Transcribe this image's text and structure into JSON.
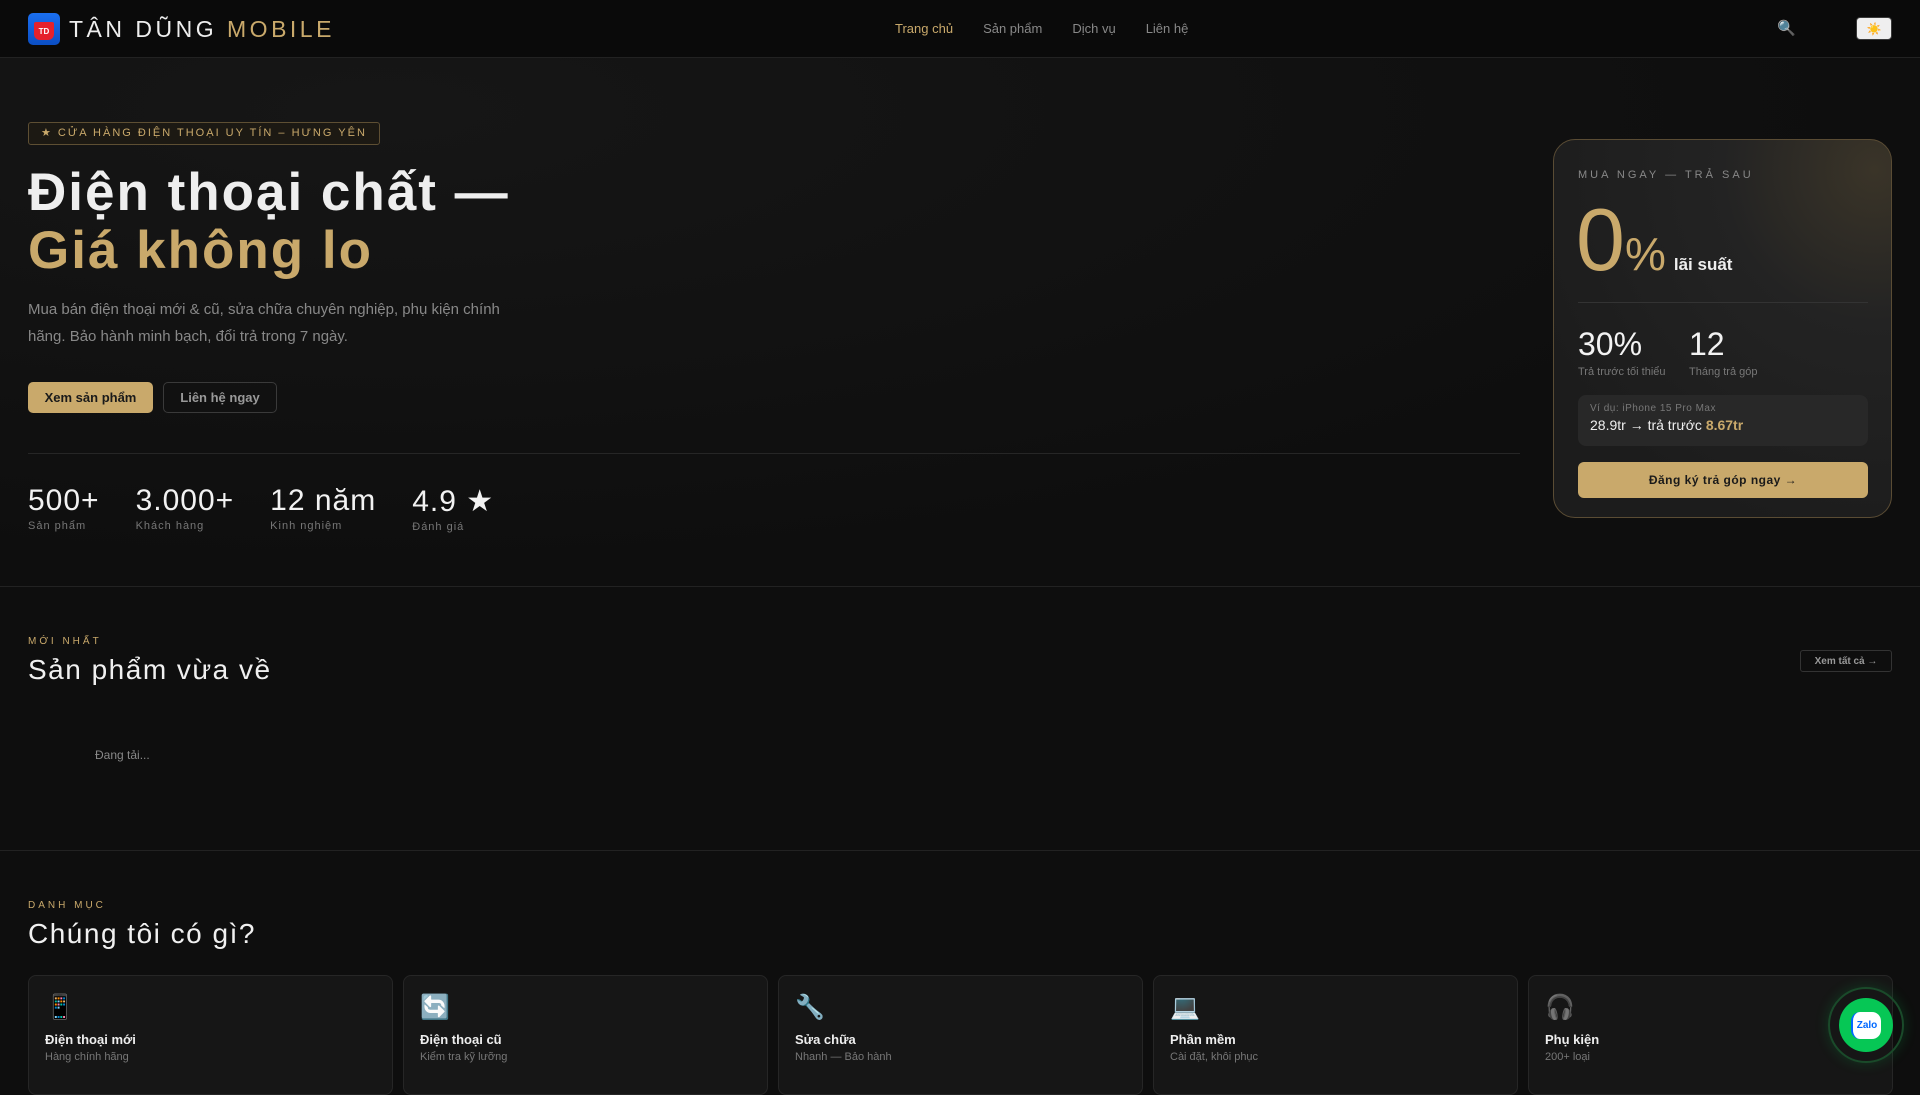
{
  "header": {
    "logo_text": "TD",
    "brand_main": "TÂN DŨNG",
    "brand_accent": "MOBILE",
    "nav": [
      {
        "label": "Trang chủ",
        "active": true
      },
      {
        "label": "Sản phẩm"
      },
      {
        "label": "Dịch vụ"
      },
      {
        "label": "Liên hệ"
      }
    ],
    "search_icon": "🔍",
    "theme_icon": "☀️"
  },
  "hero": {
    "badge": "★ CỬA HÀNG ĐIỆN THOẠI UY TÍN – HƯNG YÊN",
    "title_line1": "Điện thoại chất —",
    "title_line2": "Giá không lo",
    "subtitle": "Mua bán điện thoại mới & cũ, sửa chữa chuyên nghiệp, phụ kiện chính hãng. Bảo hành minh bạch, đổi trả trong 7 ngày.",
    "primary_button": "Xem sản phẩm",
    "secondary_button": "Liên hệ ngay",
    "stats": [
      {
        "value": "500+",
        "label": "Sản phẩm"
      },
      {
        "value": "3.000+",
        "label": "Khách hàng"
      },
      {
        "value": "12 năm",
        "label": "Kinh nghiệm"
      },
      {
        "value": "4.9 ★",
        "label": "Đánh giá"
      }
    ]
  },
  "installment": {
    "kicker": "MUA NGAY — TRẢ SAU",
    "rate": "0",
    "rate_unit": "%",
    "rate_label": "lãi suất",
    "down_payment": "30%",
    "down_payment_label": "Trả trước tối thiểu",
    "months": "12",
    "months_label": "Tháng trả góp",
    "example_label": "Ví dụ: iPhone 15 Pro Max",
    "example_price": "28.9tr → trả trước",
    "example_down": "8.67tr",
    "cta": "Đăng ký trả góp ngay →"
  },
  "new_products": {
    "eyebrow": "MỚI NHẤT",
    "title": "Sản phẩm vừa về",
    "see_all": "Xem tất cả →",
    "loading": "Đang tải..."
  },
  "categories": {
    "eyebrow": "DANH MỤC",
    "title": "Chúng tôi có gì?",
    "items": [
      {
        "icon": "📱",
        "title": "Điện thoại mới",
        "desc": "Hàng chính hãng"
      },
      {
        "icon": "🔄",
        "title": "Điện thoại cũ",
        "desc": "Kiểm tra kỹ lưỡng"
      },
      {
        "icon": "🔧",
        "title": "Sửa chữa",
        "desc": "Nhanh — Bảo hành"
      },
      {
        "icon": "💻",
        "title": "Phần mềm",
        "desc": "Cài đặt, khôi phục"
      },
      {
        "icon": "🎧",
        "title": "Phụ kiện",
        "desc": "200+ loại"
      }
    ]
  },
  "zalo": {
    "label": "Zalo"
  },
  "colors": {
    "accent": "#c9a96b",
    "background": "#0e0e0e",
    "zalo": "#06c755"
  }
}
